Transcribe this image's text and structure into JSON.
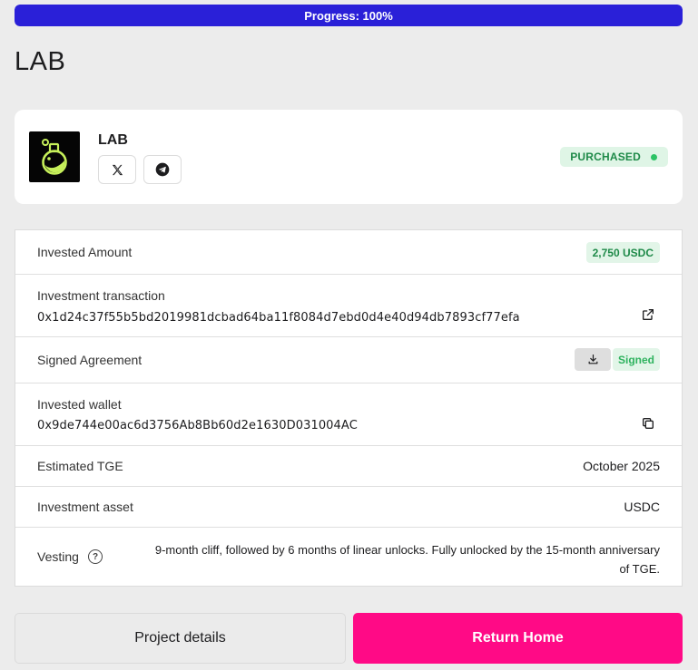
{
  "progress": {
    "text": "Progress: 100%",
    "value": 1.0,
    "color": "#2a20d8"
  },
  "page": {
    "title": "LAB"
  },
  "project": {
    "name": "LAB",
    "status": "PURCHASED",
    "status_dot_color": "#2cc365",
    "socials": [
      {
        "icon": "x-twitter-icon"
      },
      {
        "icon": "telegram-icon"
      }
    ]
  },
  "details": {
    "invested_amount": {
      "label": "Invested Amount",
      "value": "2,750 USDC"
    },
    "investment_transaction": {
      "label": "Investment transaction",
      "value": "0x1d24c37f55b5bd2019981dcbad64ba11f8084d7ebd0d4e40d94db7893cf77efa",
      "icon": "external-link-icon"
    },
    "signed_agreement": {
      "label": "Signed Agreement",
      "status": "Signed",
      "icon": "download-icon"
    },
    "invested_wallet": {
      "label": "Invested wallet",
      "value": "0x9de744e00ac6d3756Ab8Bb60d2e1630D031004AC",
      "icon": "copy-icon"
    },
    "estimated_tge": {
      "label": "Estimated TGE",
      "value": "October 2025"
    },
    "investment_asset": {
      "label": "Investment asset",
      "value": "USDC"
    },
    "vesting": {
      "label": "Vesting",
      "help_glyph": "?",
      "value": "9-month cliff, followed by 6 months of linear unlocks. Fully unlocked by the 15-month anniversary of TGE."
    }
  },
  "actions": {
    "project_details": "Project details",
    "return_home": "Return Home",
    "primary_color": "#ff0a86"
  }
}
